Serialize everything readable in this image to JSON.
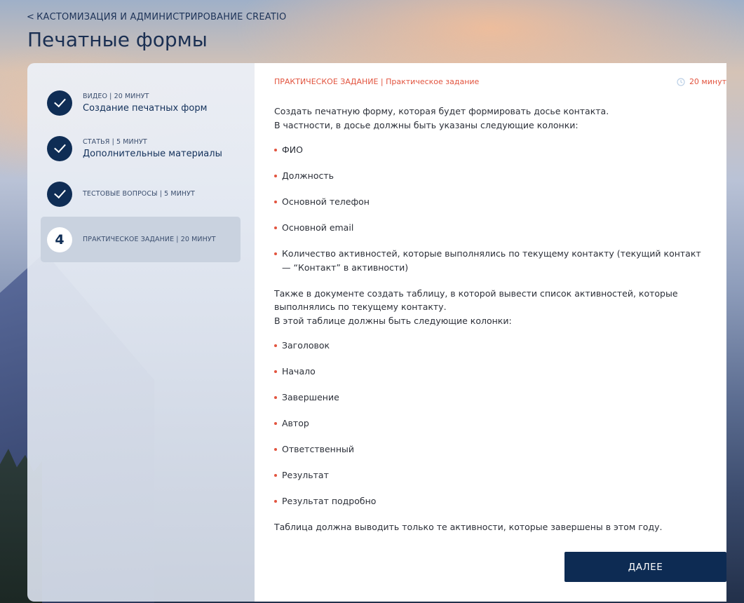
{
  "header": {
    "back_link": "КАСТОМИЗАЦИЯ И АДМИНИСТРИРОВАНИЕ CREATIO",
    "title": "Печатные формы"
  },
  "steps": [
    {
      "meta": "ВИДЕО | 20 МИНУТ",
      "name": "Создание печатных форм",
      "status": "completed"
    },
    {
      "meta": "СТАТЬЯ | 5 МИНУТ",
      "name": "Дополнительные материалы",
      "status": "completed"
    },
    {
      "meta": "ТЕСТОВЫЕ ВОПРОСЫ | 5 МИНУТ",
      "name": "",
      "status": "completed"
    },
    {
      "meta": "ПРАКТИЧЕСКОЕ ЗАДАНИЕ | 20 МИНУТ",
      "name": "",
      "number": "4",
      "status": "current"
    }
  ],
  "task": {
    "type": "ПРАКТИЧЕСКОЕ ЗАДАНИЕ",
    "separator": " | ",
    "subtitle": "Практическое задание",
    "duration": "20 минут",
    "intro_1": "Создать печатную форму, которая будет формировать досье контакта.",
    "intro_2": "В частности, в досье должны быть указаны следующие колонки:",
    "columns_1": [
      "ФИО",
      "Должность",
      "Основной телефон",
      "Основной email",
      "Количество активностей, которые выполнялись по текущему контакту (текущий контакт — “Контакт” в активности)"
    ],
    "middle_1": "Также в документе создать таблицу, в которой вывести список активностей, которые выполнялись по текущему контакту.",
    "middle_2": "В этой таблице должны быть следующие колонки:",
    "columns_2": [
      "Заголовок",
      "Начало",
      "Завершение",
      "Автор",
      "Ответственный",
      "Результат",
      "Результат подробно"
    ],
    "outro": "Таблица должна выводить только те активности, которые завершены в этом году."
  },
  "buttons": {
    "next": "ДАЛЕЕ"
  },
  "colors": {
    "accent": "#e2543f",
    "primary": "#0d2b53"
  },
  "icons": {
    "check": "check-icon",
    "clock": "clock-icon",
    "back": "chevron-left-icon"
  }
}
